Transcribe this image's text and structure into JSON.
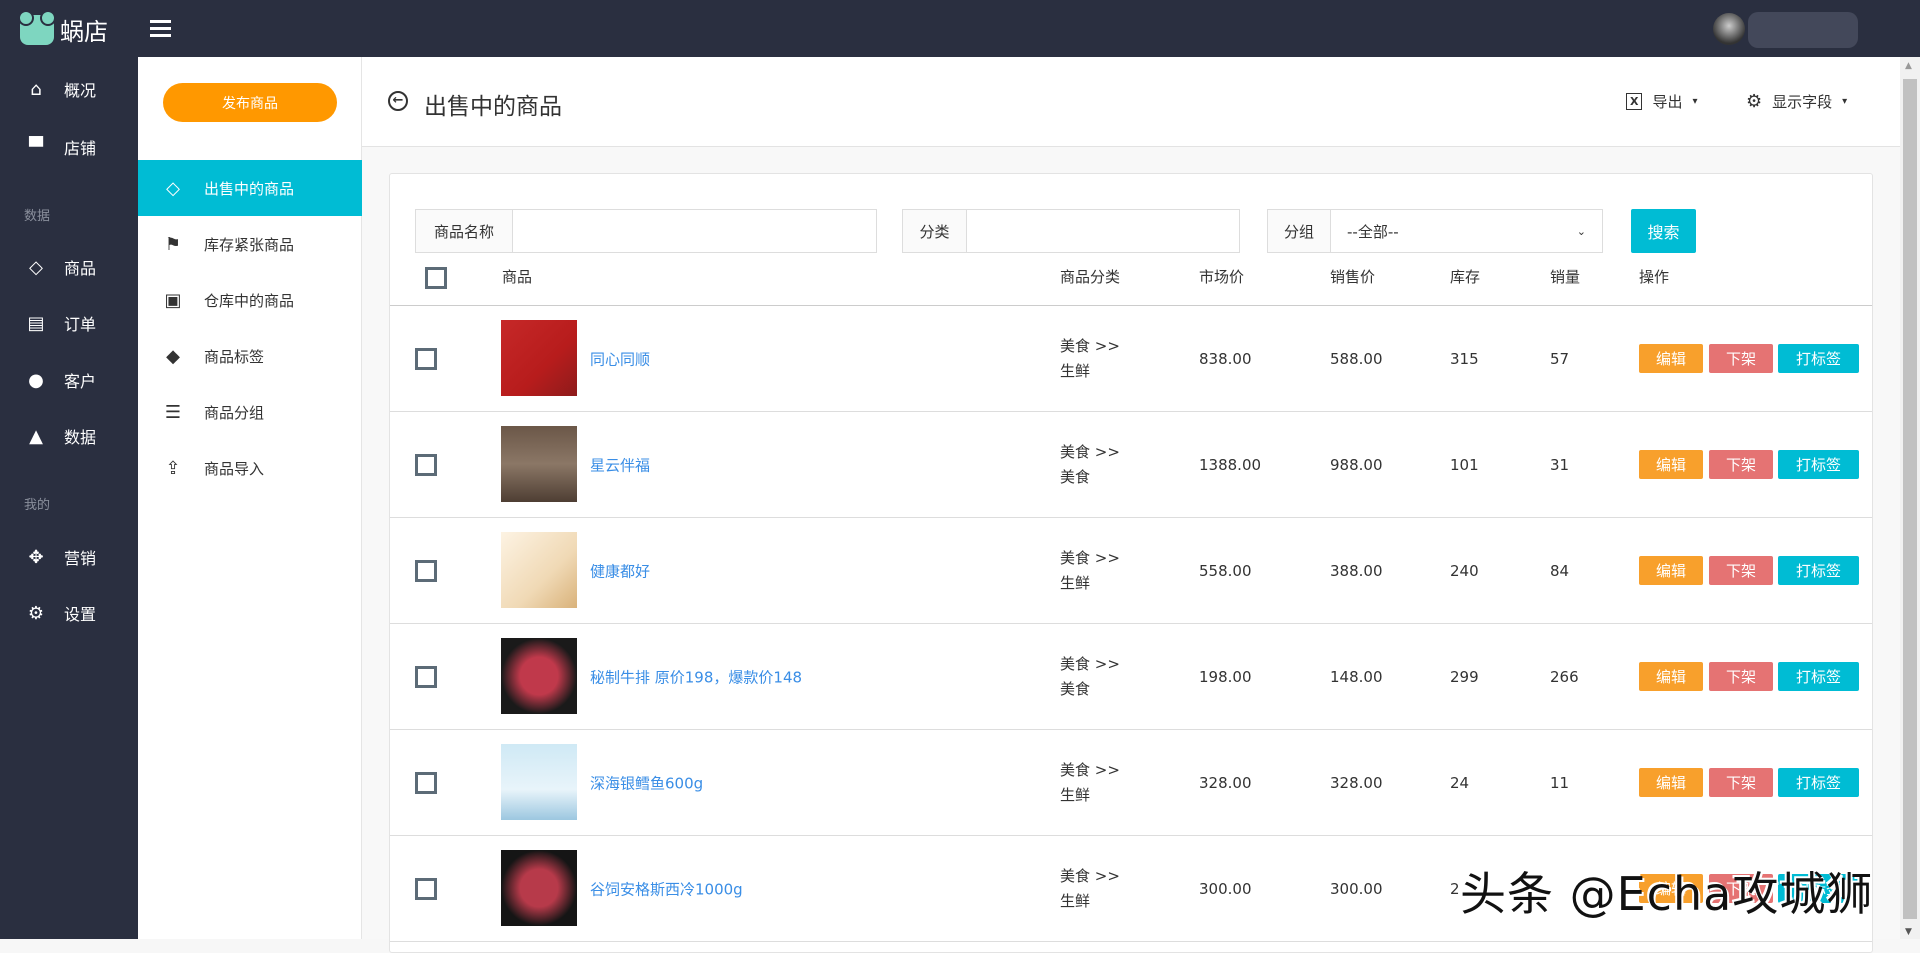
{
  "app": {
    "name": "蜗店"
  },
  "nav": {
    "items": [
      {
        "label": "概况",
        "icon": "home-icon",
        "glyph": "⌂"
      },
      {
        "label": "店铺",
        "icon": "store-icon",
        "glyph": "▀"
      },
      {
        "label": "商品",
        "icon": "tag-icon",
        "glyph": "◇"
      },
      {
        "label": "订单",
        "icon": "list-icon",
        "glyph": "▤"
      },
      {
        "label": "客户",
        "icon": "user-icon",
        "glyph": "●"
      },
      {
        "label": "数据",
        "icon": "chart-icon",
        "glyph": "▲"
      },
      {
        "label": "营销",
        "icon": "puzzle-icon",
        "glyph": "✥"
      },
      {
        "label": "设置",
        "icon": "gear-icon",
        "glyph": "⚙"
      }
    ],
    "section_data": "数据",
    "section_mine": "我的"
  },
  "subnav": {
    "publish": "发布商品",
    "items": [
      {
        "label": "出售中的商品",
        "glyph": "◇"
      },
      {
        "label": "库存紧张商品",
        "glyph": "⚑"
      },
      {
        "label": "仓库中的商品",
        "glyph": "▣"
      },
      {
        "label": "商品标签",
        "glyph": "◆"
      },
      {
        "label": "商品分组",
        "glyph": "☰"
      },
      {
        "label": "商品导入",
        "glyph": "⇪"
      }
    ]
  },
  "page": {
    "title": "出售中的商品",
    "export": "导出",
    "fields": "显示字段"
  },
  "filter": {
    "name_label": "商品名称",
    "name_value": "",
    "cat_label": "分类",
    "cat_value": "",
    "group_label": "分组",
    "group_value": "--全部--",
    "search": "搜索"
  },
  "table": {
    "headers": [
      "商品",
      "商品分类",
      "市场价",
      "销售价",
      "库存",
      "销量",
      "操作"
    ],
    "actions": {
      "edit": "编辑",
      "off": "下架",
      "tag": "打标签"
    },
    "colors": {
      "edit": "#f8a02c",
      "off": "#e57373",
      "tag": "#00bcd4"
    },
    "rows": [
      {
        "name": "同心同顺",
        "cat1": "美食 >>",
        "cat2": "生鲜",
        "market": "838.00",
        "price": "588.00",
        "stock": "315",
        "sales": "57"
      },
      {
        "name": "星云伴福",
        "cat1": "美食 >>",
        "cat2": "美食",
        "market": "1388.00",
        "price": "988.00",
        "stock": "101",
        "sales": "31"
      },
      {
        "name": "健康都好",
        "cat1": "美食 >>",
        "cat2": "生鲜",
        "market": "558.00",
        "price": "388.00",
        "stock": "240",
        "sales": "84"
      },
      {
        "name": "秘制牛排 原价198，爆款价148",
        "cat1": "美食 >>",
        "cat2": "美食",
        "market": "198.00",
        "price": "148.00",
        "stock": "299",
        "sales": "266"
      },
      {
        "name": "深海银鳕鱼600g",
        "cat1": "美食 >>",
        "cat2": "生鲜",
        "market": "328.00",
        "price": "328.00",
        "stock": "24",
        "sales": "11"
      },
      {
        "name": "谷饲安格斯西冷1000g",
        "cat1": "美食 >>",
        "cat2": "生鲜",
        "market": "300.00",
        "price": "300.00",
        "stock": "2",
        "sales": ""
      }
    ]
  },
  "watermark": "头条 @Echa攻城狮"
}
